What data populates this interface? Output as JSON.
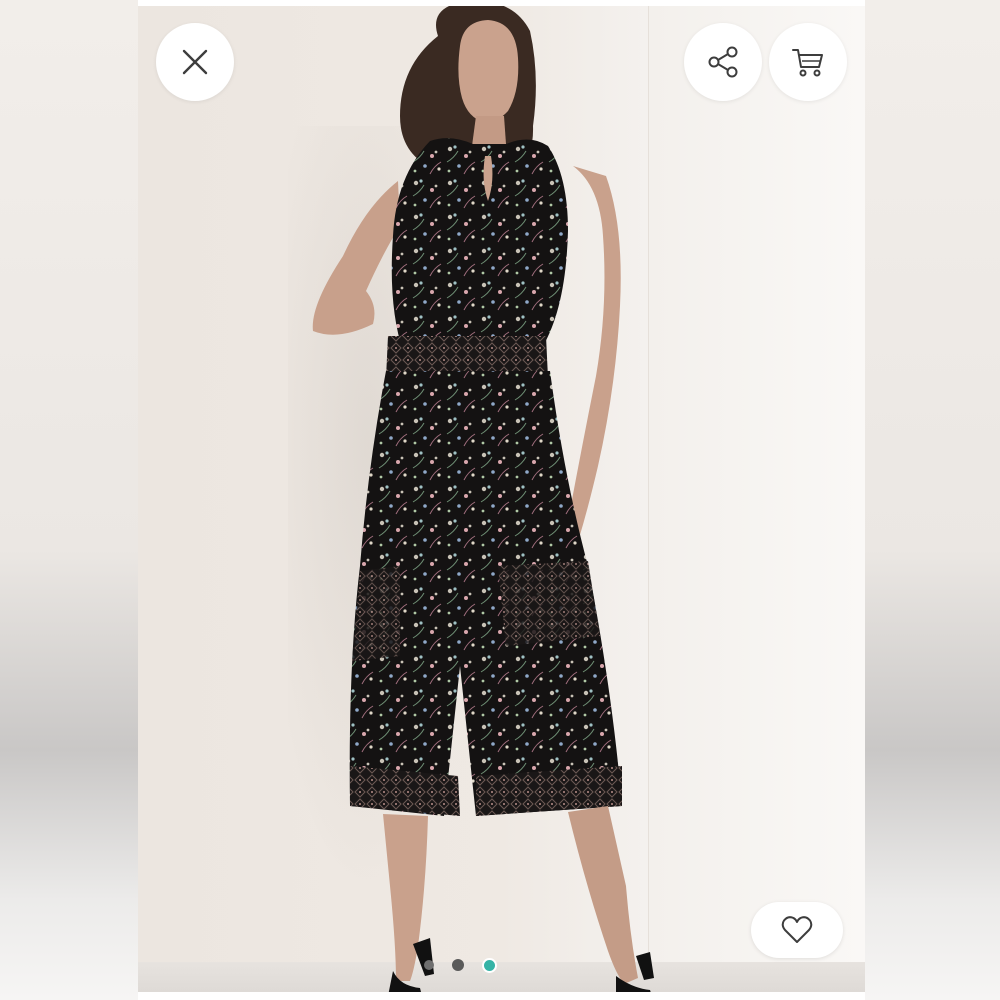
{
  "viewer": {
    "close_icon": "close-icon",
    "share_icon": "share-icon",
    "cart_icon": "cart-icon",
    "like_icon": "heart-outline-icon"
  },
  "carousel": {
    "total": 3,
    "active_index": 3,
    "dot_colors": [
      "#6f6f6f",
      "#5a5a5a",
      "#35b3a6"
    ]
  },
  "colors": {
    "icon_stroke": "#3d3d3d",
    "button_bg": "#ffffff",
    "accent": "#35b3a6"
  }
}
